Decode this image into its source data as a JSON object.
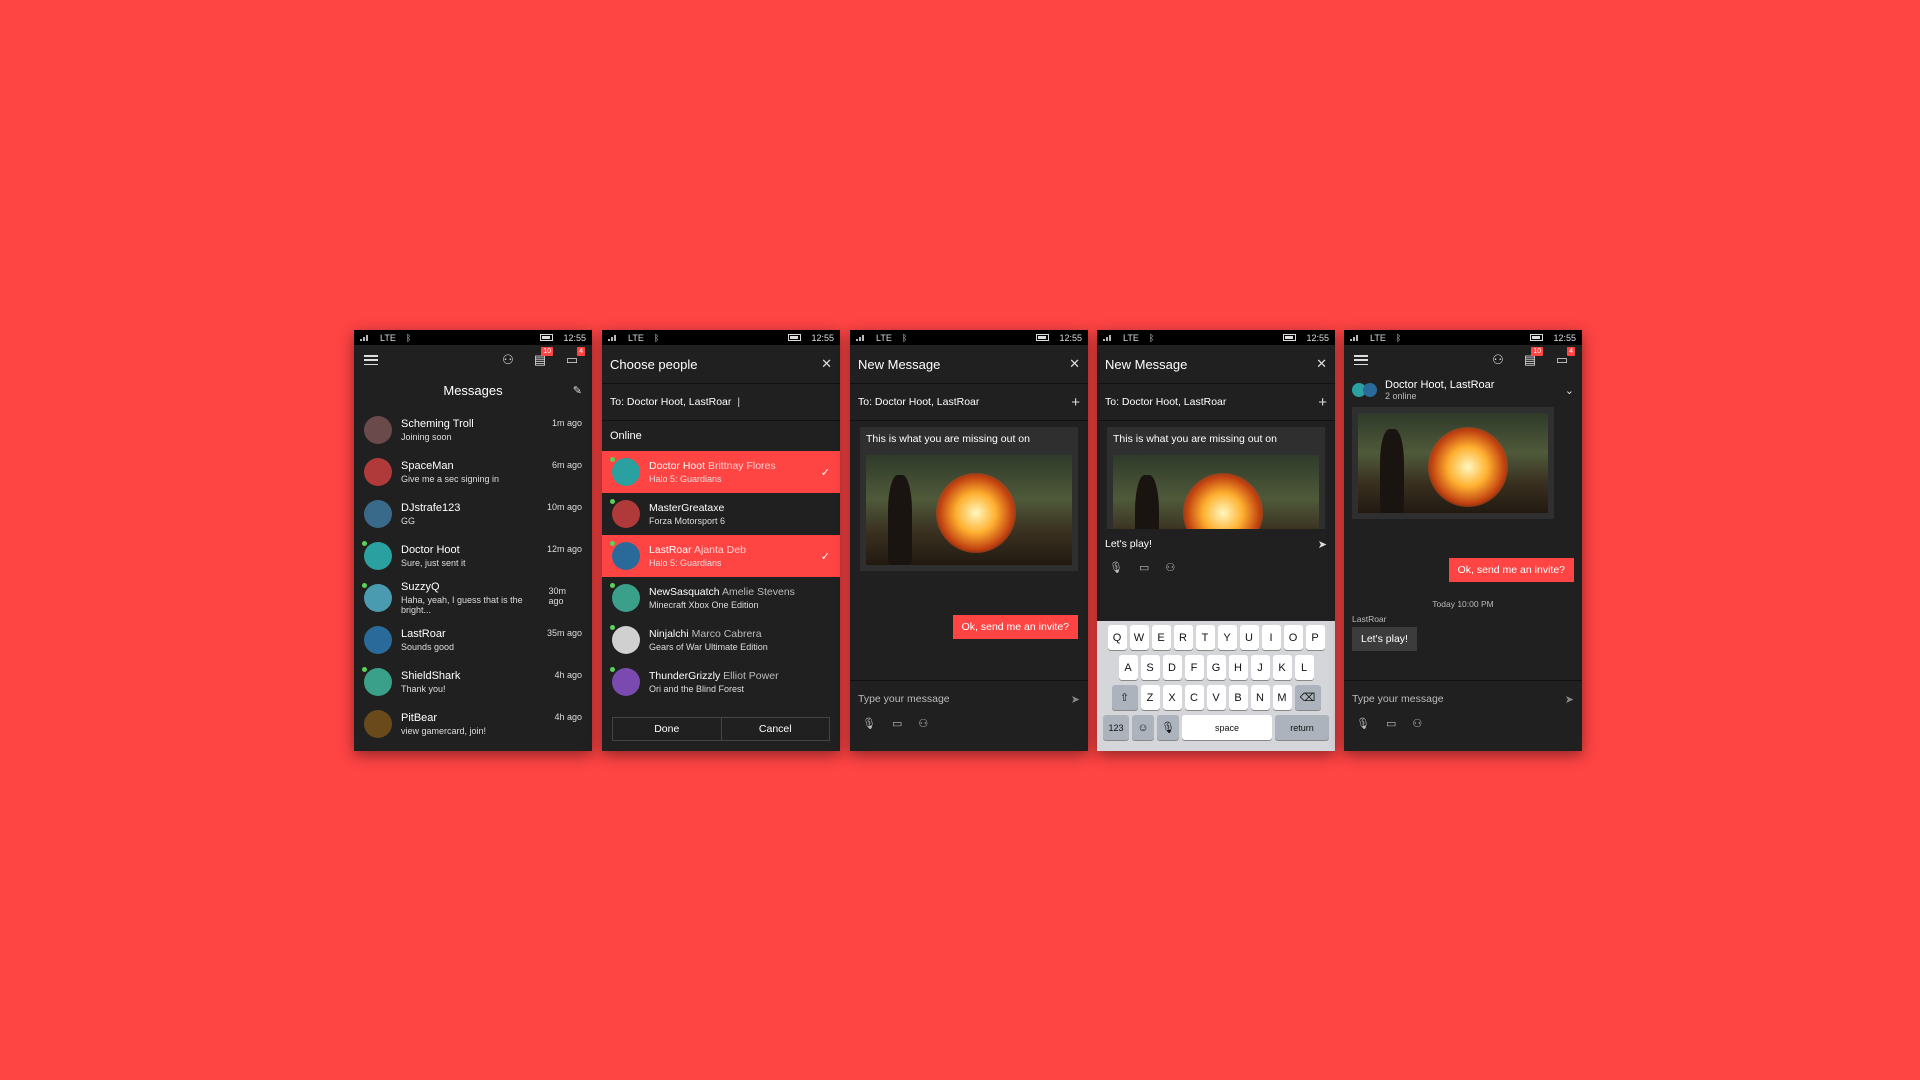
{
  "colors": {
    "background": "#ff4444",
    "accent": "#ff4444",
    "panel": "#202020",
    "online": "#5bd15b"
  },
  "status": {
    "network": "LTE",
    "time": "12:55"
  },
  "badges": {
    "chat": "10",
    "notifications": "4"
  },
  "screen1": {
    "title": "Messages",
    "items": [
      {
        "name": "Scheming Troll",
        "preview": "Joining soon",
        "time": "1m ago",
        "color": "#6a4a4a",
        "online": false
      },
      {
        "name": "SpaceMan",
        "preview": "Give me a sec signing in",
        "time": "6m ago",
        "color": "#b03a3a",
        "online": false
      },
      {
        "name": "DJstrafe123",
        "preview": "GG",
        "time": "10m ago",
        "color": "#3a6a8a",
        "online": false
      },
      {
        "name": "Doctor Hoot",
        "preview": "Sure, just sent it",
        "time": "12m ago",
        "color": "#2aa0a0",
        "online": true
      },
      {
        "name": "SuzzyQ",
        "preview": "Haha, yeah, I guess that is the bright...",
        "time": "30m ago",
        "color": "#4a9ab0",
        "online": true
      },
      {
        "name": "LastRoar",
        "preview": "Sounds good",
        "time": "35m ago",
        "color": "#2a6a9a",
        "online": false
      },
      {
        "name": "ShieldShark",
        "preview": "Thank you!",
        "time": "4h ago",
        "color": "#3aa08a",
        "online": true
      },
      {
        "name": "PitBear",
        "preview": "view gamercard, join!",
        "time": "4h ago",
        "color": "#6a4a1a",
        "online": false
      }
    ]
  },
  "screen2": {
    "title": "Choose people",
    "to": "To: Doctor Hoot,  LastRoar",
    "section": "Online",
    "items": [
      {
        "gamertag": "Doctor Hoot",
        "real": "Brittnay Flores",
        "game": "Halo 5: Guardians",
        "selected": true,
        "color": "#2aa0a0"
      },
      {
        "gamertag": "MasterGreataxe",
        "real": "",
        "game": "Forza Motorsport 6",
        "selected": false,
        "color": "#b03a3a"
      },
      {
        "gamertag": "LastRoar",
        "real": "Ajanta Deb",
        "game": "Halo 5: Guardians",
        "selected": true,
        "color": "#2a6a9a"
      },
      {
        "gamertag": "NewSasquatch",
        "real": "Amelie Stevens",
        "game": "Minecraft Xbox One Edition",
        "selected": false,
        "color": "#3aa08a"
      },
      {
        "gamertag": "Ninjalchi",
        "real": "Marco Cabrera",
        "game": "Gears of War Ultimate Edition",
        "selected": false,
        "color": "#d0d0d0"
      },
      {
        "gamertag": "ThunderGrizzly",
        "real": "Elliot Power",
        "game": "Ori and the Blind Forest",
        "selected": false,
        "color": "#7a4ab0"
      }
    ],
    "done": "Done",
    "cancel": "Cancel"
  },
  "screen3": {
    "title": "New Message",
    "to": "To: Doctor Hoot,  LastRoar",
    "card_caption": "This is what you are missing out on",
    "bubble": "Ok, send me an invite?",
    "placeholder": "Type your message"
  },
  "screen4": {
    "title": "New Message",
    "to": "To: Doctor Hoot,  LastRoar",
    "card_caption": "This is what you are missing out on",
    "draft": "Let's play!",
    "keys_row1": [
      "Q",
      "W",
      "E",
      "R",
      "T",
      "Y",
      "U",
      "I",
      "O",
      "P"
    ],
    "keys_row2": [
      "A",
      "S",
      "D",
      "F",
      "G",
      "H",
      "J",
      "K",
      "L"
    ],
    "keys_row3": [
      "Z",
      "X",
      "C",
      "V",
      "B",
      "N",
      "M"
    ],
    "key_123": "123",
    "key_space": "space",
    "key_return": "return"
  },
  "screen5": {
    "title": "Doctor Hoot, LastRoar",
    "subtitle": "2 online",
    "bubble_mine": "Ok, send me an invite?",
    "timestamp": "Today 10:00 PM",
    "sender": "LastRoar",
    "bubble_theirs": "Let's play!",
    "placeholder": "Type your message"
  }
}
